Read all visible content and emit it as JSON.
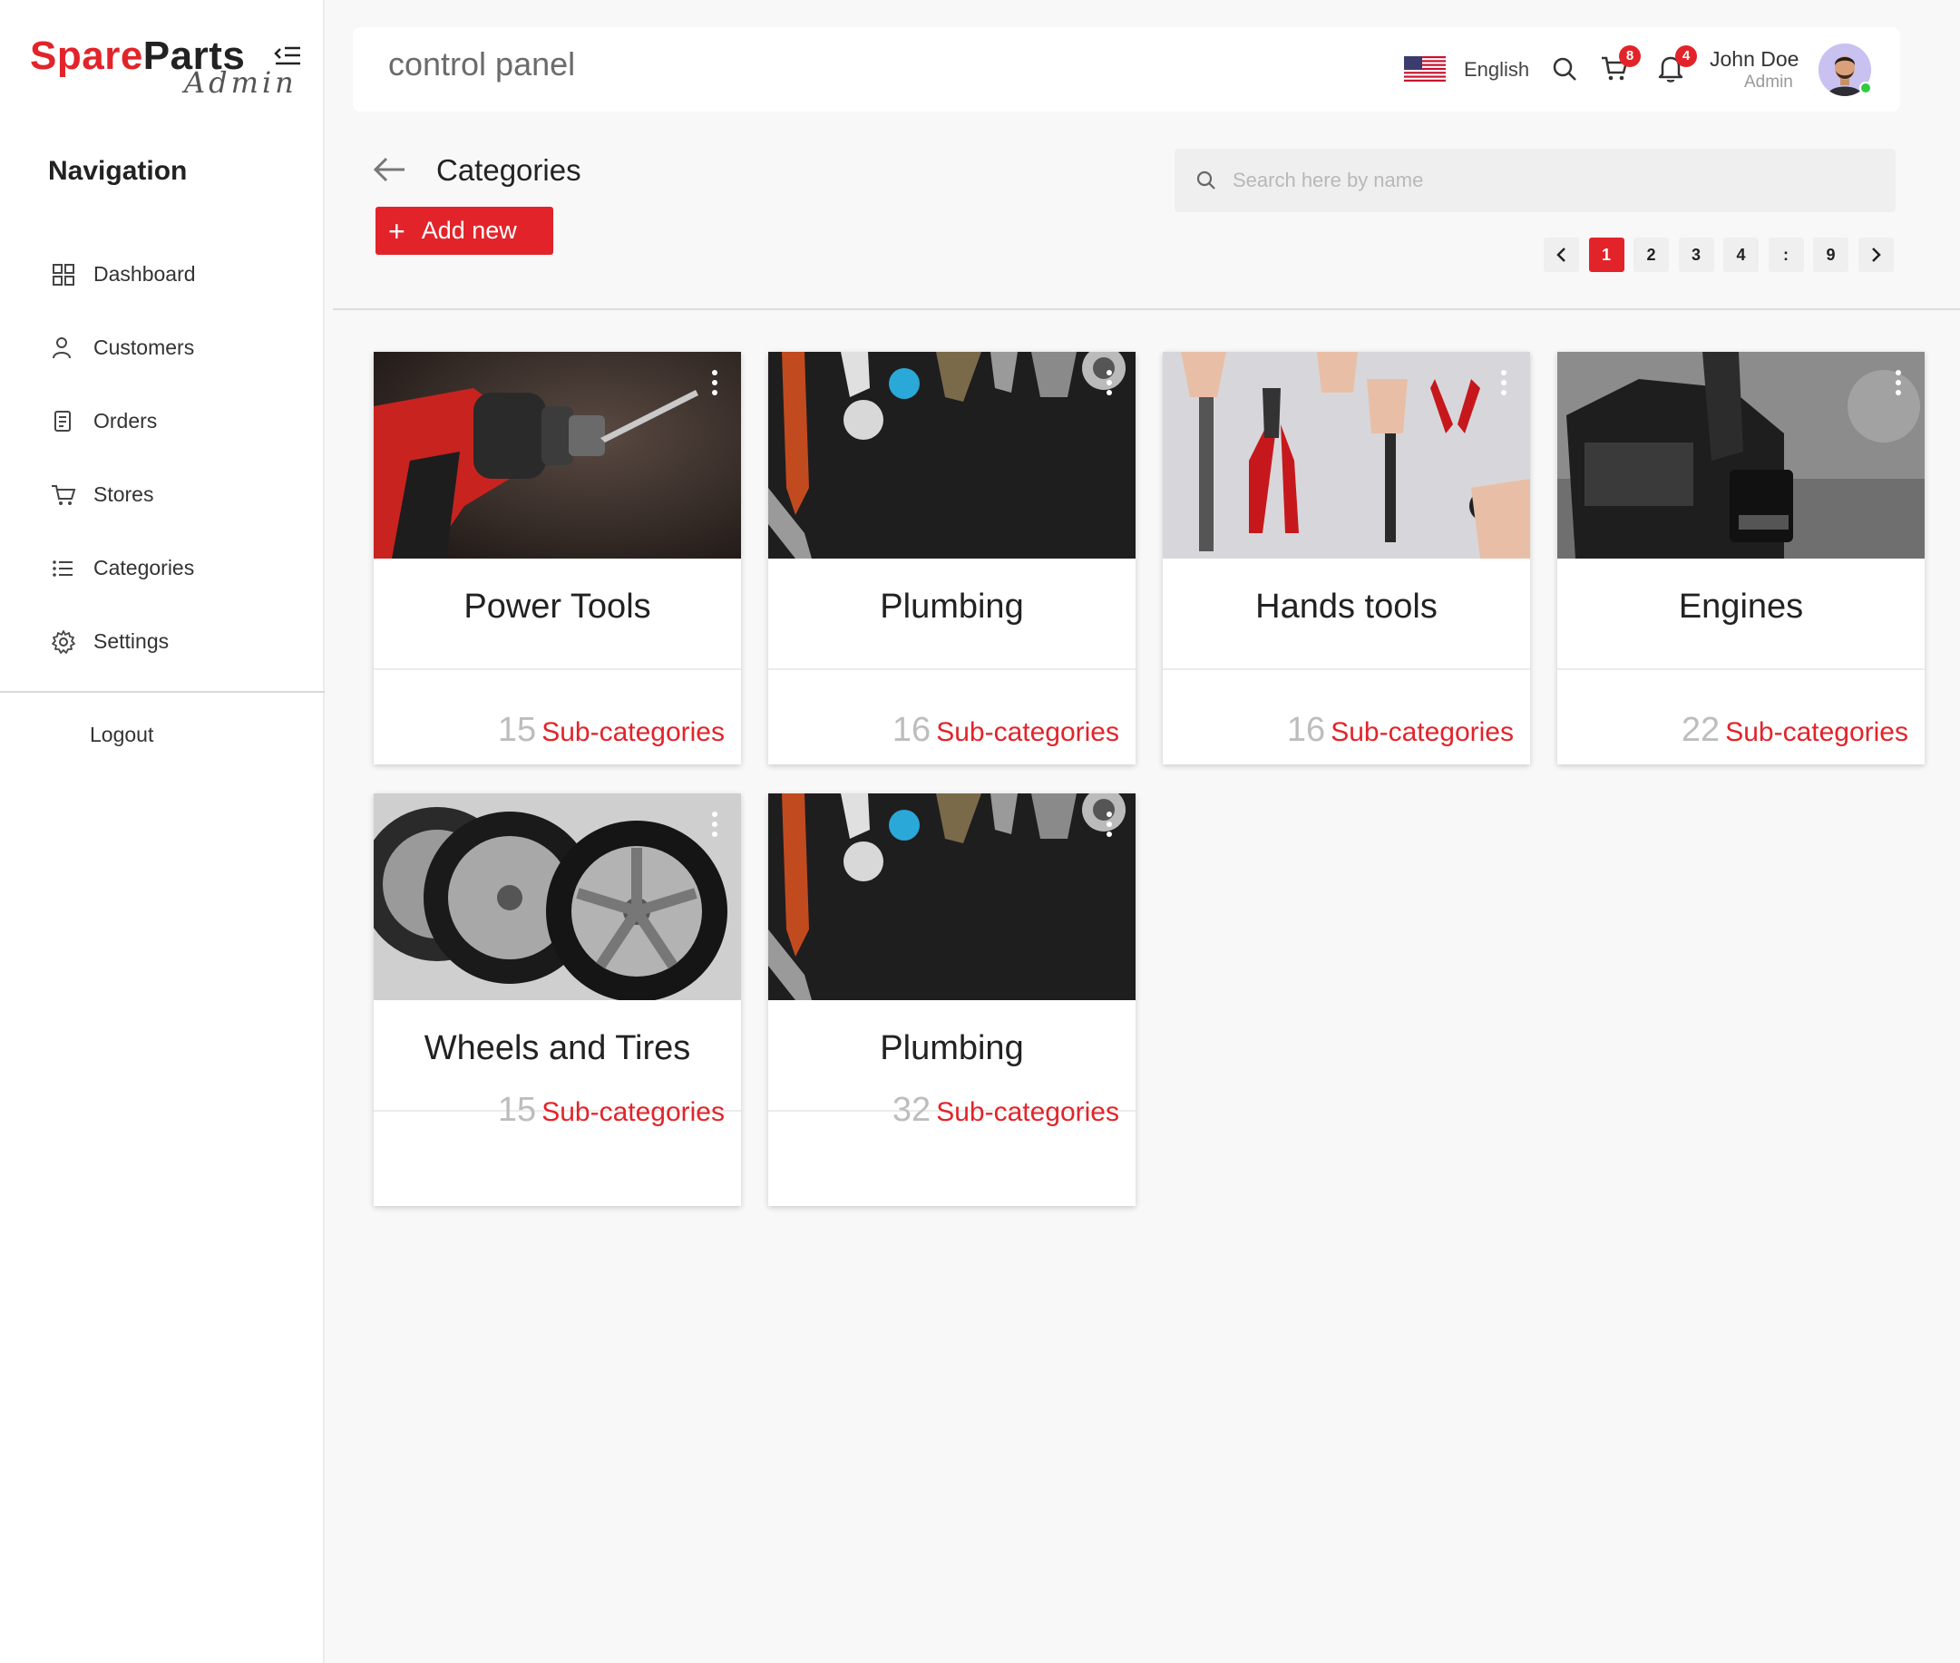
{
  "brand": {
    "name_part1": "Spare",
    "name_part2": "Parts",
    "subtitle": "Admin",
    "accent_color": "#e2242a"
  },
  "sidebar": {
    "title": "Navigation",
    "items": [
      {
        "label": "Dashboard",
        "icon": "grid-icon"
      },
      {
        "label": "Customers",
        "icon": "user-icon"
      },
      {
        "label": "Orders",
        "icon": "document-icon"
      },
      {
        "label": "Stores",
        "icon": "cart-icon"
      },
      {
        "label": "Categories",
        "icon": "list-icon"
      },
      {
        "label": "Settings",
        "icon": "gear-icon"
      }
    ],
    "logout_label": "Logout"
  },
  "header": {
    "title": "control panel",
    "language": "English",
    "cart_count": "8",
    "notification_count": "4",
    "user": {
      "name": "John Doe",
      "role": "Admin"
    }
  },
  "page": {
    "title": "Categories",
    "add_button_label": "Add new",
    "search_placeholder": "Search here by name",
    "pagination": {
      "pages": [
        "1",
        "2",
        "3",
        "4",
        ":",
        "9"
      ],
      "current": "1"
    }
  },
  "categories": [
    {
      "name": "Power Tools",
      "count": "15",
      "sub_label": "Sub-categories",
      "image": "drill"
    },
    {
      "name": "Plumbing",
      "count": "16",
      "sub_label": "Sub-categories",
      "image": "plumbing-tools"
    },
    {
      "name": "Hands tools",
      "count": "16",
      "sub_label": "Sub-categories",
      "image": "hand-tools"
    },
    {
      "name": "Engines",
      "count": "22",
      "sub_label": "Sub-categories",
      "image": "engine"
    },
    {
      "name": "Wheels and Tires",
      "count": "15",
      "sub_label": "Sub-categories",
      "image": "wheels"
    },
    {
      "name": "Plumbing",
      "count": "32",
      "sub_label": "Sub-categories",
      "image": "plumbing-tools"
    }
  ]
}
